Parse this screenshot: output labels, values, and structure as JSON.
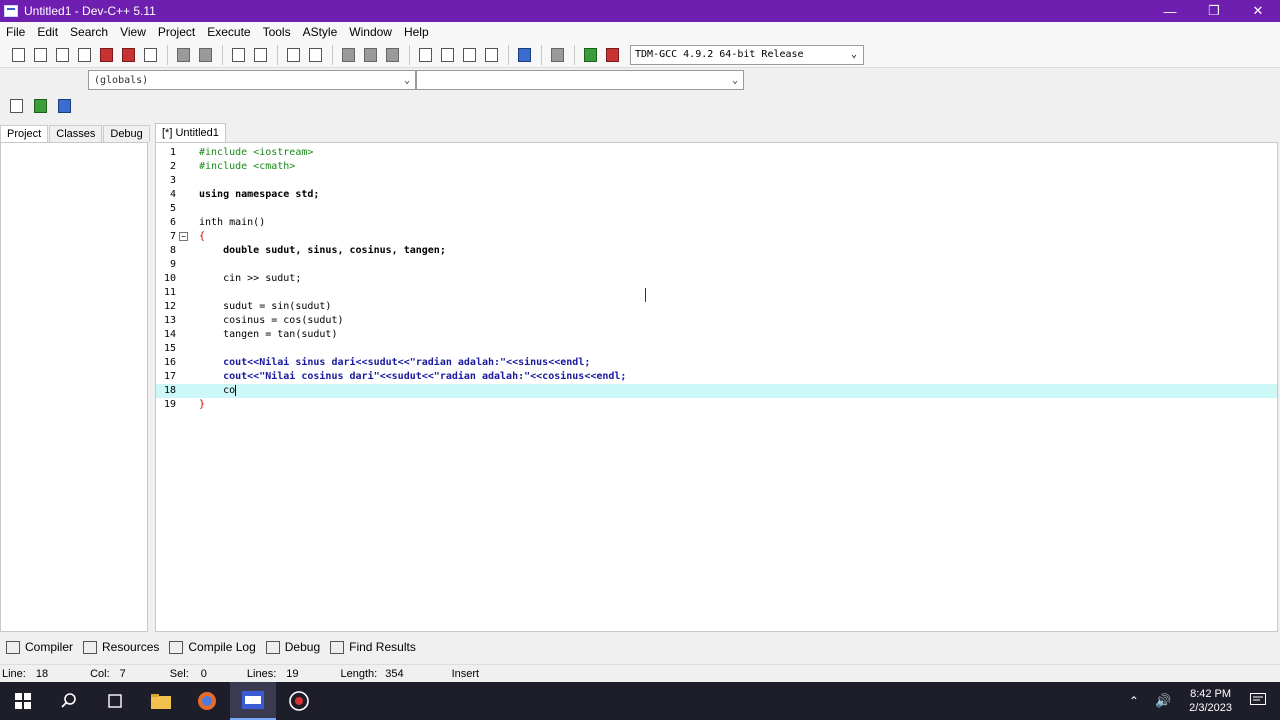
{
  "window": {
    "title": "Untitled1 - Dev-C++ 5.11"
  },
  "menu": [
    "File",
    "Edit",
    "Search",
    "View",
    "Project",
    "Execute",
    "Tools",
    "AStyle",
    "Window",
    "Help"
  ],
  "toolbar": {
    "compiler": "TDM-GCC 4.9.2 64-bit Release"
  },
  "scope_combo": {
    "value": "(globals)"
  },
  "left_panel": {
    "tabs": [
      "Project",
      "Classes",
      "Debug"
    ]
  },
  "editor": {
    "tab": "[*] Untitled1",
    "current_line": 18,
    "lines": [
      "#include <iostream>",
      "#include <cmath>",
      "",
      "using namespace std;",
      "",
      "inth main()",
      "{",
      "    double sudut, sinus, cosinus, tangen;",
      "",
      "    cin >> sudut;",
      "",
      "    sudut = sin(sudut)",
      "    cosinus = cos(sudut)",
      "    tangen = tan(sudut)",
      "",
      "    cout<<Nilai sinus dari<<sudut<<\"radian adalah:\"<<sinus<<endl;",
      "    cout<<\"Nilai cosinus dari\"<<sudut<<\"radian adalah:\"<<cosinus<<endl;",
      "    co",
      "}"
    ]
  },
  "bottom_tabs": [
    "Compiler",
    "Resources",
    "Compile Log",
    "Debug",
    "Find Results"
  ],
  "status": {
    "line_label": "Line:",
    "line_value": "18",
    "col_label": "Col:",
    "col_value": "7",
    "sel_label": "Sel:",
    "sel_value": "0",
    "lines_label": "Lines:",
    "lines_value": "19",
    "length_label": "Length:",
    "length_value": "354",
    "mode": "Insert"
  },
  "taskbar": {
    "time": "8:42 PM",
    "date": "2/3/2023"
  },
  "colors": {
    "titlebar": "#6f1fb0",
    "current_line": "#ccf8f8",
    "preprocessor": "#1a8a1a",
    "string": "#1a1aa0",
    "brace": "#cc0000"
  }
}
